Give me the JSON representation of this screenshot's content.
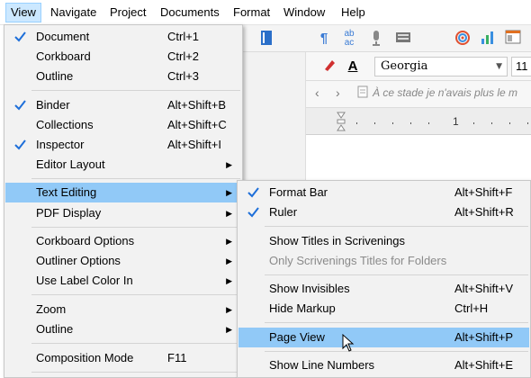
{
  "menubar": {
    "items": [
      {
        "label": "View",
        "name": "menu-view"
      },
      {
        "label": "Navigate",
        "name": "menu-navigate"
      },
      {
        "label": "Project",
        "name": "menu-project"
      },
      {
        "label": "Documents",
        "name": "menu-documents"
      },
      {
        "label": "Format",
        "name": "menu-format"
      },
      {
        "label": "Window",
        "name": "menu-window"
      },
      {
        "label": "Help",
        "name": "menu-help"
      }
    ]
  },
  "format_bar": {
    "font": "Georgia",
    "size": "11"
  },
  "editor": {
    "doc_title": "À ce stade je n'avais plus le m",
    "ruler_number": "1"
  },
  "view_menu": {
    "items": [
      {
        "label": "Document",
        "shortcut": "Ctrl+1",
        "checked": true
      },
      {
        "label": "Corkboard",
        "shortcut": "Ctrl+2"
      },
      {
        "label": "Outline",
        "shortcut": "Ctrl+3"
      },
      {
        "label": "Binder",
        "shortcut": "Alt+Shift+B",
        "checked": true
      },
      {
        "label": "Collections",
        "shortcut": "Alt+Shift+C"
      },
      {
        "label": "Inspector",
        "shortcut": "Alt+Shift+I",
        "checked": true
      },
      {
        "label": "Editor Layout",
        "submenu": true
      },
      {
        "label": "Text Editing",
        "submenu": true,
        "highlighted": true
      },
      {
        "label": "PDF Display",
        "submenu": true
      },
      {
        "label": "Corkboard Options",
        "submenu": true
      },
      {
        "label": "Outliner Options",
        "submenu": true
      },
      {
        "label": "Use Label Color In",
        "submenu": true
      },
      {
        "label": "Zoom",
        "submenu": true
      },
      {
        "label": "Outline",
        "submenu": true
      },
      {
        "label": "Composition Mode",
        "shortcut": "F11"
      }
    ]
  },
  "text_editing_menu": {
    "items": [
      {
        "label": "Format Bar",
        "shortcut": "Alt+Shift+F",
        "checked": true
      },
      {
        "label": "Ruler",
        "shortcut": "Alt+Shift+R",
        "checked": true
      },
      {
        "label": "Show Titles in Scrivenings"
      },
      {
        "label": "Only Scrivenings Titles for Folders",
        "disabled": true
      },
      {
        "label": "Show Invisibles",
        "shortcut": "Alt+Shift+V"
      },
      {
        "label": "Hide Markup",
        "shortcut": "Ctrl+H"
      },
      {
        "label": "Page View",
        "shortcut": "Alt+Shift+P",
        "highlighted": true
      },
      {
        "label": "Show Line Numbers",
        "shortcut": "Alt+Shift+E"
      }
    ]
  },
  "colors": {
    "highlight": "#91c9f7",
    "menu_bg": "#f2f2f2",
    "check": "#1e6fd9",
    "active_menu": "#cce8ff"
  }
}
